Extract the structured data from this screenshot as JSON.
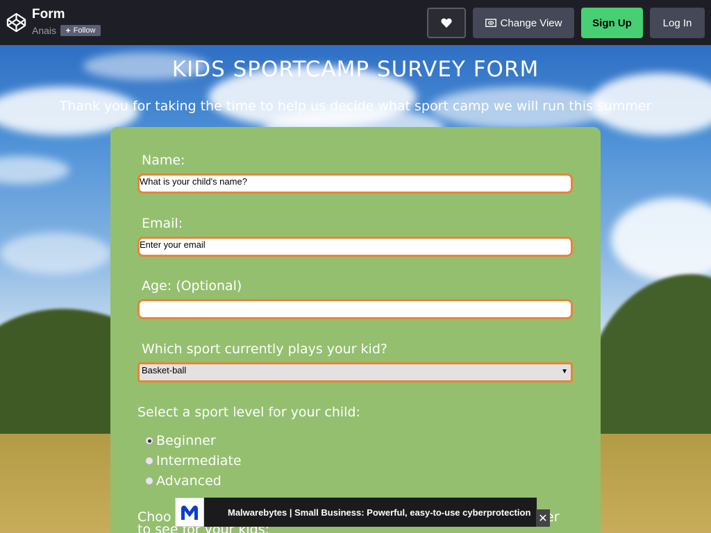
{
  "header": {
    "pen_title": "Form",
    "author": "Anais",
    "follow_label": "Follow",
    "change_view_label": "Change View",
    "sign_up_label": "Sign Up",
    "log_in_label": "Log In",
    "icons": [
      "codepen-logo-icon",
      "heart-icon",
      "change-view-icon"
    ]
  },
  "page": {
    "title": "KIDS SPORTCAMP SURVEY FORM",
    "subtitle": "Thank you for taking the time to help us decide what sport camp we will run this summer"
  },
  "form": {
    "name_label": "Name:",
    "name_placeholder": "What is your child's name?",
    "email_label": "Email:",
    "email_placeholder": "Enter your email",
    "age_label": "Age: (Optional)",
    "age_value": "",
    "sport_label": "Which sport currently plays your kid?",
    "sport_selected": "Basket-ball",
    "level_label": "Select a sport level for your child:",
    "levels": [
      {
        "label": "Beginner",
        "checked": true
      },
      {
        "label": "Intermediate",
        "checked": false
      },
      {
        "label": "Advanced",
        "checked": false
      }
    ],
    "next_question_partial_1": "Choo",
    "next_question_partial_1_end": "er",
    "next_question_partial_2": "to see for your kids:"
  },
  "ad": {
    "text": "Malwarebytes | Small Business: Powerful, easy-to-use cyberprotection",
    "close_label": "✕"
  },
  "colors": {
    "topbar": "#1e1f26",
    "sign_up": "#47cf73",
    "card": "#94bf6f",
    "input_border": "#e8843a"
  }
}
